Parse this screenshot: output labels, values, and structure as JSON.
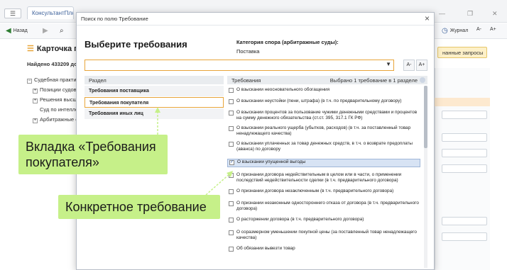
{
  "app": {
    "tab_title": "КонсультантПлюс",
    "menu_glyph": "☰",
    "toolbar": {
      "back_label": "Назад",
      "journal_label": "Журнал",
      "font_decrease": "A-",
      "font_increase": "A+"
    },
    "page_title": "Карточка по",
    "found_text": "Найдено 433209 до",
    "tree": [
      {
        "prefix": "−",
        "label": "Судебная практик"
      },
      {
        "prefix": "+",
        "label": "Позиции судов к"
      },
      {
        "prefix": "+",
        "label": "Решения высши"
      },
      {
        "prefix": "",
        "label": "Суд по интеллек"
      },
      {
        "prefix": "+",
        "label": "Арбитражные су"
      }
    ],
    "saved_queries_label": "нанные запросы"
  },
  "modal": {
    "window_title": "Поиск по полю Требование",
    "heading": "Выберите требования",
    "category_label": "Категория спора (арбитражные суды):",
    "category_value": "Поставка",
    "search_placeholder": "",
    "font_decrease": "A-",
    "font_increase": "A+",
    "sections_header": "Раздел",
    "sections": [
      {
        "label": "Требования поставщика",
        "active": false
      },
      {
        "label": "Требования покупателя",
        "active": true
      },
      {
        "label": "Требования иных лиц",
        "active": false
      }
    ],
    "requirements_header": "Требования",
    "selected_count": "Выбрано 1 требование в 1 разделе",
    "requirements": [
      {
        "text": "О взыскании неосновательного обогащения",
        "checked": false
      },
      {
        "text": "О взыскании неустойки (пени, штрафа) (в т.ч. по предварительному договору)",
        "checked": false
      },
      {
        "text": "О взыскании процентов за пользование чужими денежными средствами и процентов на сумму денежного обязательства (ст.ст. 395, 317.1 ГК РФ)",
        "checked": false
      },
      {
        "text": "О взыскании реального ущерба (убытков, расходов) (в т.ч. за поставленный товар ненадлежащего качества)",
        "checked": false
      },
      {
        "text": "О взыскании уплаченных за товар денежных средств, в т.ч. о возврате предоплаты (аванса) по договору",
        "checked": false
      },
      {
        "text": "О взыскании упущенной выгоды",
        "checked": true
      },
      {
        "text": "О признании договора недействительным в целом или в части, о применении последствий недействительности сделки (в т.ч. предварительного договора)",
        "checked": false
      },
      {
        "text": "О признании договора незаключенным (в т.ч. предварительного договора)",
        "checked": false
      },
      {
        "text": "О признании незаконным одностороннего отказа от договора (в т.ч. предварительного договора)",
        "checked": false
      },
      {
        "text": "О расторжении договора (в т.ч. предварительного договора)",
        "checked": false
      },
      {
        "text": "О соразмерном уменьшении покупной цены (за поставленный товар ненадлежащего качества)",
        "checked": false
      },
      {
        "text": "Об обязании вывезти товар",
        "checked": false
      }
    ]
  },
  "callouts": {
    "tab_callout": "Вкладка «Требования покупателя»",
    "tab_callout_line1": "Вкладка «Требования",
    "tab_callout_line2": "покупателя»",
    "requirement_callout": "Конкретное требование"
  },
  "colors": {
    "accent_orange": "#e8a53a",
    "callout_green": "#c6f089",
    "selection_blue": "#d7e3f4"
  }
}
